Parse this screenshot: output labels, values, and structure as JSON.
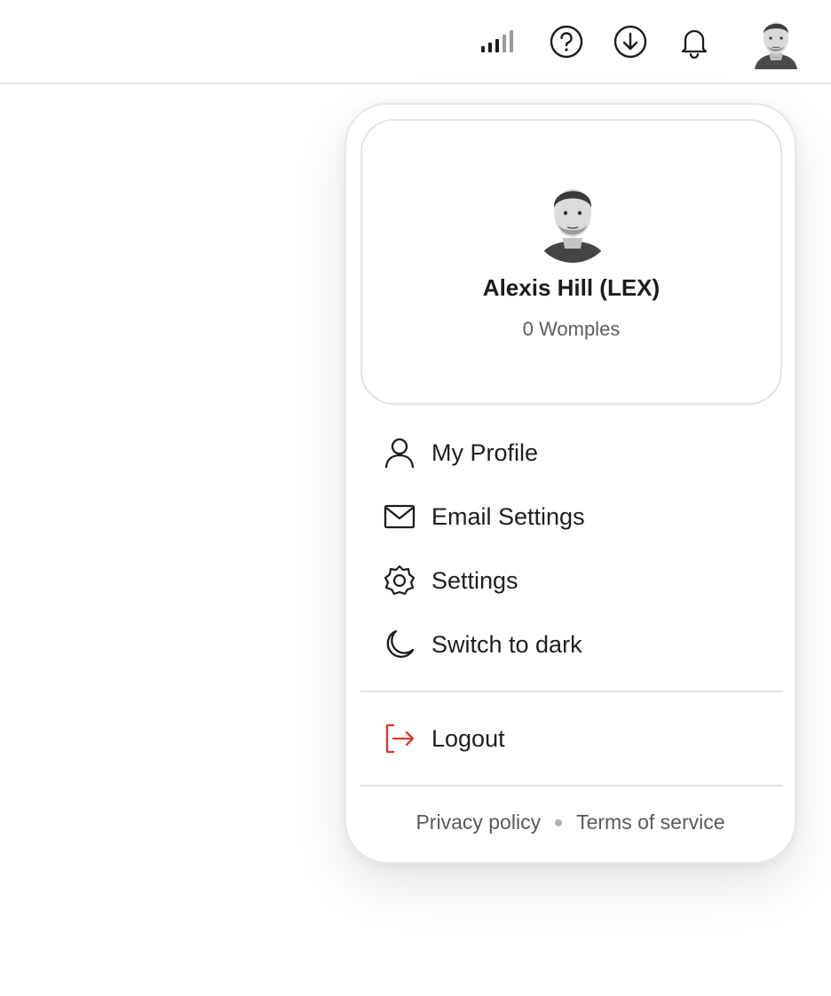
{
  "topbar": {
    "icons": [
      "signal-strength-icon",
      "help-icon",
      "download-icon",
      "bell-icon"
    ],
    "avatar": "user-avatar"
  },
  "profile": {
    "name": "Alexis Hill (LEX)",
    "points": "0 Womples"
  },
  "menu": {
    "items": [
      {
        "label": "My Profile",
        "icon": "user-icon"
      },
      {
        "label": "Email Settings",
        "icon": "mail-icon"
      },
      {
        "label": "Settings",
        "icon": "gear-icon"
      },
      {
        "label": "Switch to dark",
        "icon": "moon-icon"
      }
    ],
    "logout": {
      "label": "Logout",
      "icon": "logout-icon",
      "color": "#e0362c"
    }
  },
  "footer": {
    "privacy": "Privacy policy",
    "terms": "Terms of service"
  }
}
